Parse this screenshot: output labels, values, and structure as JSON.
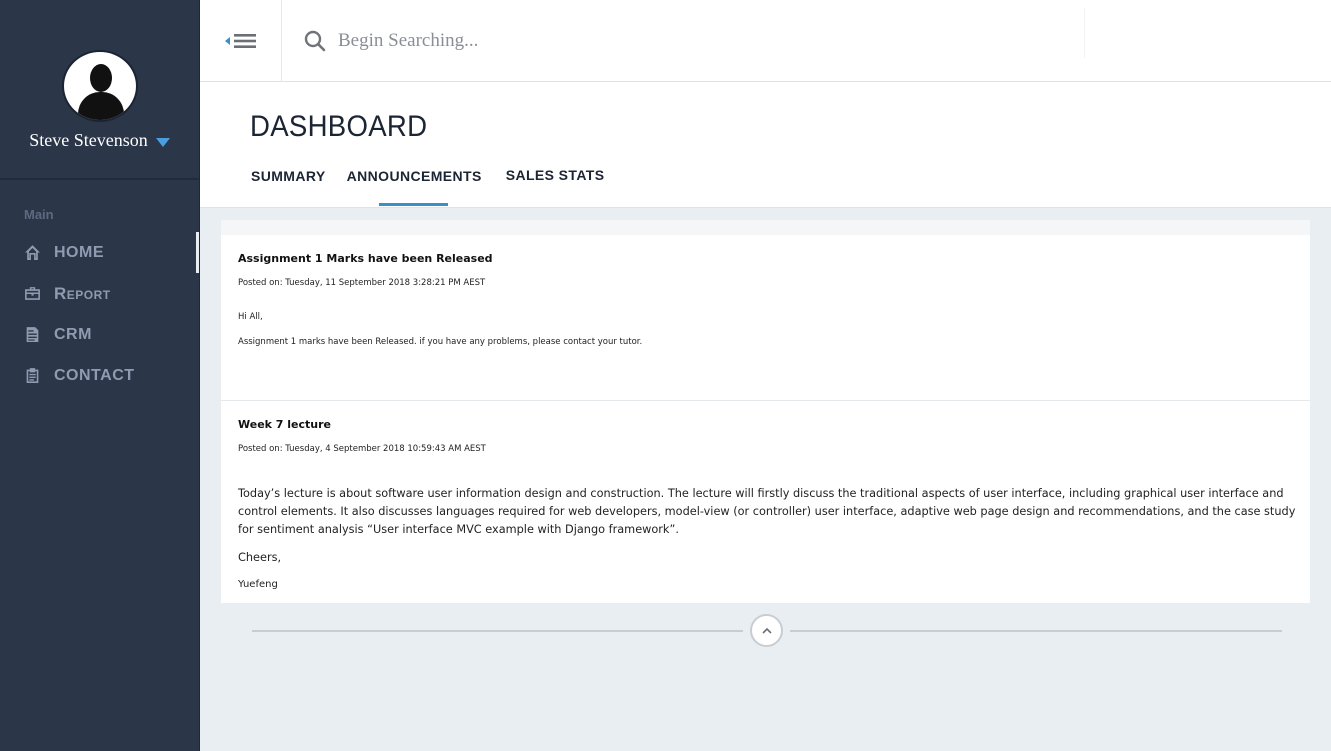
{
  "user": {
    "name": "Steve Stevenson"
  },
  "sidebar": {
    "section_label": "Main",
    "items": [
      {
        "label": "HOME",
        "icon": "home-icon"
      },
      {
        "label": "Report",
        "icon": "briefcase-icon"
      },
      {
        "label": "CRM",
        "icon": "document-icon"
      },
      {
        "label": "CONTACT",
        "icon": "clipboard-icon"
      }
    ]
  },
  "search": {
    "placeholder": "Begin Searching..."
  },
  "header": {
    "title": "DASHBOARD",
    "tabs": [
      {
        "label": "SUMMARY"
      },
      {
        "label": "ANNOUNCEMENTS"
      },
      {
        "label": "SALES STATS"
      }
    ],
    "active_tab": "ANNOUNCEMENTS"
  },
  "announcements": [
    {
      "title": "Assignment 1 Marks have been Released",
      "posted": "Posted on: Tuesday, 11 September 2018 3:28:21 PM AEST",
      "greeting": "Hi All,",
      "body": "Assignment 1 marks have been Released. if you have any problems, please contact your tutor."
    },
    {
      "title": "Week 7 lecture",
      "posted": "Posted on: Tuesday, 4 September 2018 10:59:43 AM AEST",
      "body": "Today’s lecture is about software user information design and construction. The lecture will firstly discuss the traditional aspects of user interface, including graphical user interface and control elements. It also discusses languages required for web developers, model-view (or controller) user interface, adaptive web page design and recommendations, and the case study for sentiment analysis “User interface MVC example with Django framework”.",
      "closing": "Cheers,",
      "signature": "Yuefeng"
    }
  ],
  "colors": {
    "sidebar_bg": "#2b3649",
    "accent": "#3a8ec9",
    "caret": "#4a9ee0",
    "content_bg": "#e9eef3"
  }
}
